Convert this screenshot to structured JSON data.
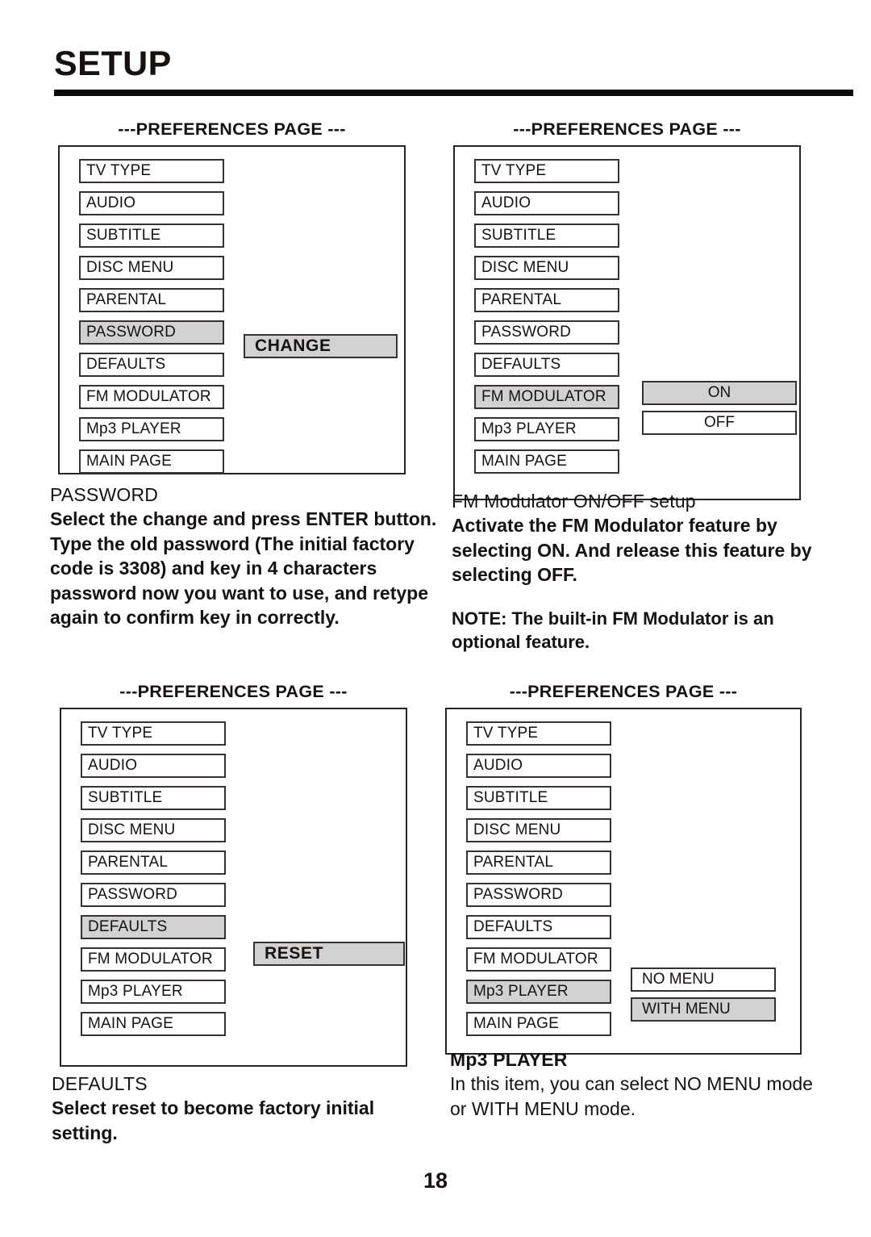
{
  "header": {
    "title": "SETUP"
  },
  "panels": [
    {
      "caption": "---PREFERENCES PAGE ---",
      "items": [
        {
          "label": "TV  TYPE",
          "selected": false
        },
        {
          "label": "AUDIO",
          "selected": false
        },
        {
          "label": "SUBTITLE",
          "selected": false
        },
        {
          "label": "DISC MENU",
          "selected": false
        },
        {
          "label": "PARENTAL",
          "selected": false
        },
        {
          "label": "PASSWORD",
          "selected": true
        },
        {
          "label": "DEFAULTS",
          "selected": false
        },
        {
          "label": "FM MODULATOR",
          "selected": false
        },
        {
          "label": "Mp3 PLAYER",
          "selected": false
        },
        {
          "label": "MAIN PAGE",
          "selected": false
        }
      ],
      "options": [
        {
          "label": "CHANGE",
          "selected": true
        }
      ]
    },
    {
      "caption": "---PREFERENCES PAGE ---",
      "items": [
        {
          "label": "TV TYPE",
          "selected": false
        },
        {
          "label": "AUDIO",
          "selected": false
        },
        {
          "label": "SUBTITLE",
          "selected": false
        },
        {
          "label": "DISC MENU",
          "selected": false
        },
        {
          "label": "PARENTAL",
          "selected": false
        },
        {
          "label": "PASSWORD",
          "selected": false
        },
        {
          "label": "DEFAULTS",
          "selected": false
        },
        {
          "label": "FM MODULATOR",
          "selected": true
        },
        {
          "label": "Mp3 PLAYER",
          "selected": false
        },
        {
          "label": "MAIN PAGE",
          "selected": false
        }
      ],
      "options": [
        {
          "label": "ON",
          "selected": true
        },
        {
          "label": "OFF",
          "selected": false
        }
      ]
    },
    {
      "caption": "---PREFERENCES PAGE ---",
      "items": [
        {
          "label": "TV  TYPE",
          "selected": false
        },
        {
          "label": "AUDIO",
          "selected": false
        },
        {
          "label": "SUBTITLE",
          "selected": false
        },
        {
          "label": "DISC MENU",
          "selected": false
        },
        {
          "label": "PARENTAL",
          "selected": false
        },
        {
          "label": "PASSWORD",
          "selected": false
        },
        {
          "label": "DEFAULTS",
          "selected": true
        },
        {
          "label": "FM MODULATOR",
          "selected": false
        },
        {
          "label": "Mp3 PLAYER",
          "selected": false
        },
        {
          "label": "MAIN PAGE",
          "selected": false
        }
      ],
      "options": [
        {
          "label": "RESET",
          "selected": true
        }
      ]
    },
    {
      "caption": "---PREFERENCES PAGE ---",
      "items": [
        {
          "label": "TV  TYPE",
          "selected": false
        },
        {
          "label": "AUDIO",
          "selected": false
        },
        {
          "label": "SUBTITLE",
          "selected": false
        },
        {
          "label": "DISC MENU",
          "selected": false
        },
        {
          "label": "PARENTAL",
          "selected": false
        },
        {
          "label": "PASSWORD",
          "selected": false
        },
        {
          "label": "DEFAULTS",
          "selected": false
        },
        {
          "label": "FM MODULATOR",
          "selected": false
        },
        {
          "label": "Mp3 PLAYER",
          "selected": true
        },
        {
          "label": "MAIN PAGE",
          "selected": false
        }
      ],
      "options": [
        {
          "label": "NO MENU",
          "selected": false
        },
        {
          "label": "WITH MENU",
          "selected": true
        }
      ]
    }
  ],
  "descriptions": {
    "password": {
      "title": "PASSWORD",
      "body": "Select the change and press ENTER button.  Type the old password (The initial factory code is 3308) and key in 4 characters password now you want to use, and retype again to confirm key in correctly."
    },
    "fm_modulator": {
      "line1": "FM Modulator ON/OFF setup",
      "body": "Activate the FM Modulator feature by selecting ON. And release this feature by selecting OFF.",
      "note": "NOTE: The built-in FM Modulator is an optional feature."
    },
    "defaults": {
      "title": "DEFAULTS",
      "body": "Select reset to become factory initial setting."
    },
    "mp3_player": {
      "title": "Mp3 PLAYER",
      "body": "In this item, you can select NO MENU mode or WITH MENU mode."
    }
  },
  "footer": {
    "page_number": "18"
  },
  "colors": {
    "selected_fill": "#d2d2d2",
    "border": "#3a302c",
    "text": "#17120f"
  }
}
